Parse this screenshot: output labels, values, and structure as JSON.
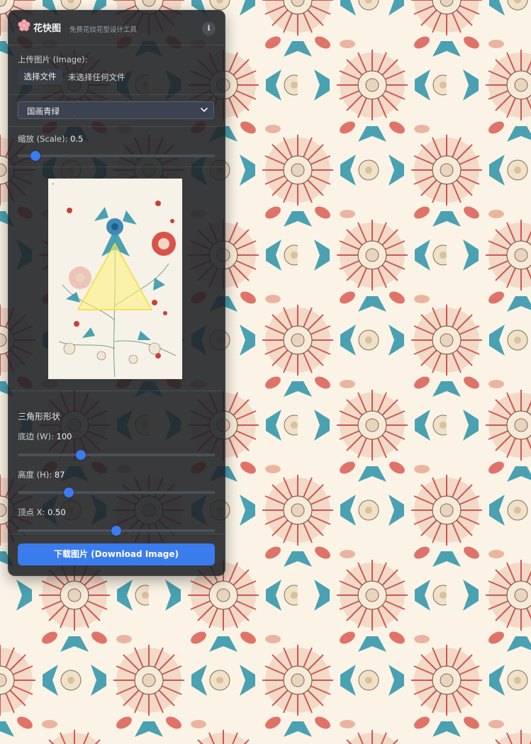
{
  "app": {
    "title": "花快图",
    "subtitle": "免费花纹花型设计工具",
    "info_label": "i"
  },
  "upload": {
    "label": "上传图片 (Image):",
    "button_label": "选择文件",
    "status": "未选择任何文件"
  },
  "style_select": {
    "value": "国画青绿"
  },
  "scale": {
    "label": "缩放 (Scale): ",
    "value": "0.5",
    "fraction": 0.09
  },
  "triangle": {
    "heading": "三角形形状",
    "base": {
      "label": "底边 (W): ",
      "value": "100",
      "fraction": 0.32
    },
    "height": {
      "label": "高度 (H): ",
      "value": "87",
      "fraction": 0.26
    },
    "apex": {
      "label": "顶点 X: ",
      "value": "0.50",
      "fraction": 0.5
    }
  },
  "download": {
    "label": "下载图片 (Download Image)"
  },
  "colors": {
    "accent": "#3b7cf0",
    "panel": "#1e2024",
    "background": "#fbf4e6",
    "petal_red": "#c8413a",
    "leaf_teal": "#2c93a8"
  },
  "icons": {
    "logo": "cherry-blossom-icon",
    "info": "info-icon",
    "select_arrow": "chevron-down-icon"
  }
}
